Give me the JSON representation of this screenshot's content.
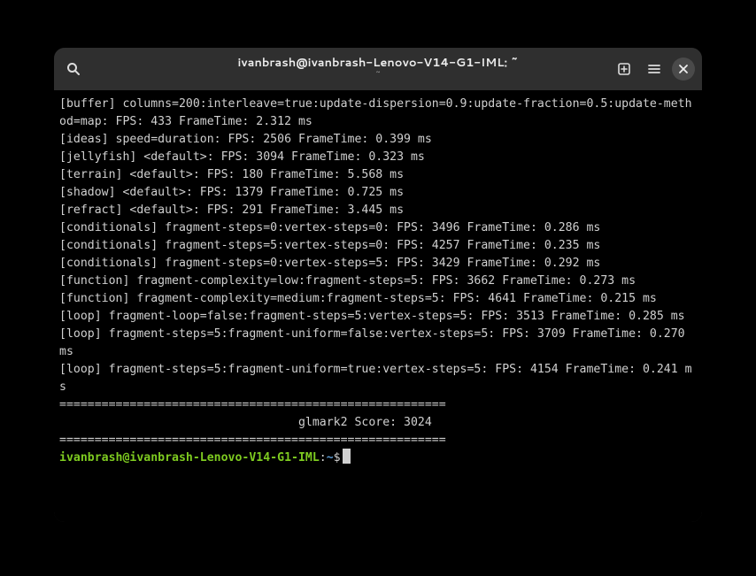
{
  "window": {
    "title": "ivanbrash@ivanbrash-Lenovo-V14-G1-IML: ~",
    "subtitle": "~"
  },
  "icons": {
    "search": "search-icon",
    "new_tab": "new-tab-icon",
    "menu": "hamburger-icon",
    "close": "close-icon"
  },
  "terminal": {
    "lines": [
      "[buffer] columns=200:interleave=true:update-dispersion=0.9:update-fraction=0.5:update-method=map: FPS: 433 FrameTime: 2.312 ms",
      "[ideas] speed=duration: FPS: 2506 FrameTime: 0.399 ms",
      "[jellyfish] <default>: FPS: 3094 FrameTime: 0.323 ms",
      "[terrain] <default>: FPS: 180 FrameTime: 5.568 ms",
      "[shadow] <default>: FPS: 1379 FrameTime: 0.725 ms",
      "[refract] <default>: FPS: 291 FrameTime: 3.445 ms",
      "[conditionals] fragment-steps=0:vertex-steps=0: FPS: 3496 FrameTime: 0.286 ms",
      "[conditionals] fragment-steps=5:vertex-steps=0: FPS: 4257 FrameTime: 0.235 ms",
      "[conditionals] fragment-steps=0:vertex-steps=5: FPS: 3429 FrameTime: 0.292 ms",
      "[function] fragment-complexity=low:fragment-steps=5: FPS: 3662 FrameTime: 0.273 ms",
      "[function] fragment-complexity=medium:fragment-steps=5: FPS: 4641 FrameTime: 0.215 ms",
      "[loop] fragment-loop=false:fragment-steps=5:vertex-steps=5: FPS: 3513 FrameTime: 0.285 ms",
      "[loop] fragment-steps=5:fragment-uniform=false:vertex-steps=5: FPS: 3709 FrameTime: 0.270 ms",
      "[loop] fragment-steps=5:fragment-uniform=true:vertex-steps=5: FPS: 4154 FrameTime: 0.241 ms",
      "=======================================================",
      "                                  glmark2 Score: 3024 ",
      "======================================================="
    ],
    "prompt": {
      "user_host": "ivanbrash@ivanbrash-Lenovo-V14-G1-IML",
      "colon": ":",
      "path": "~",
      "symbol": "$"
    }
  }
}
